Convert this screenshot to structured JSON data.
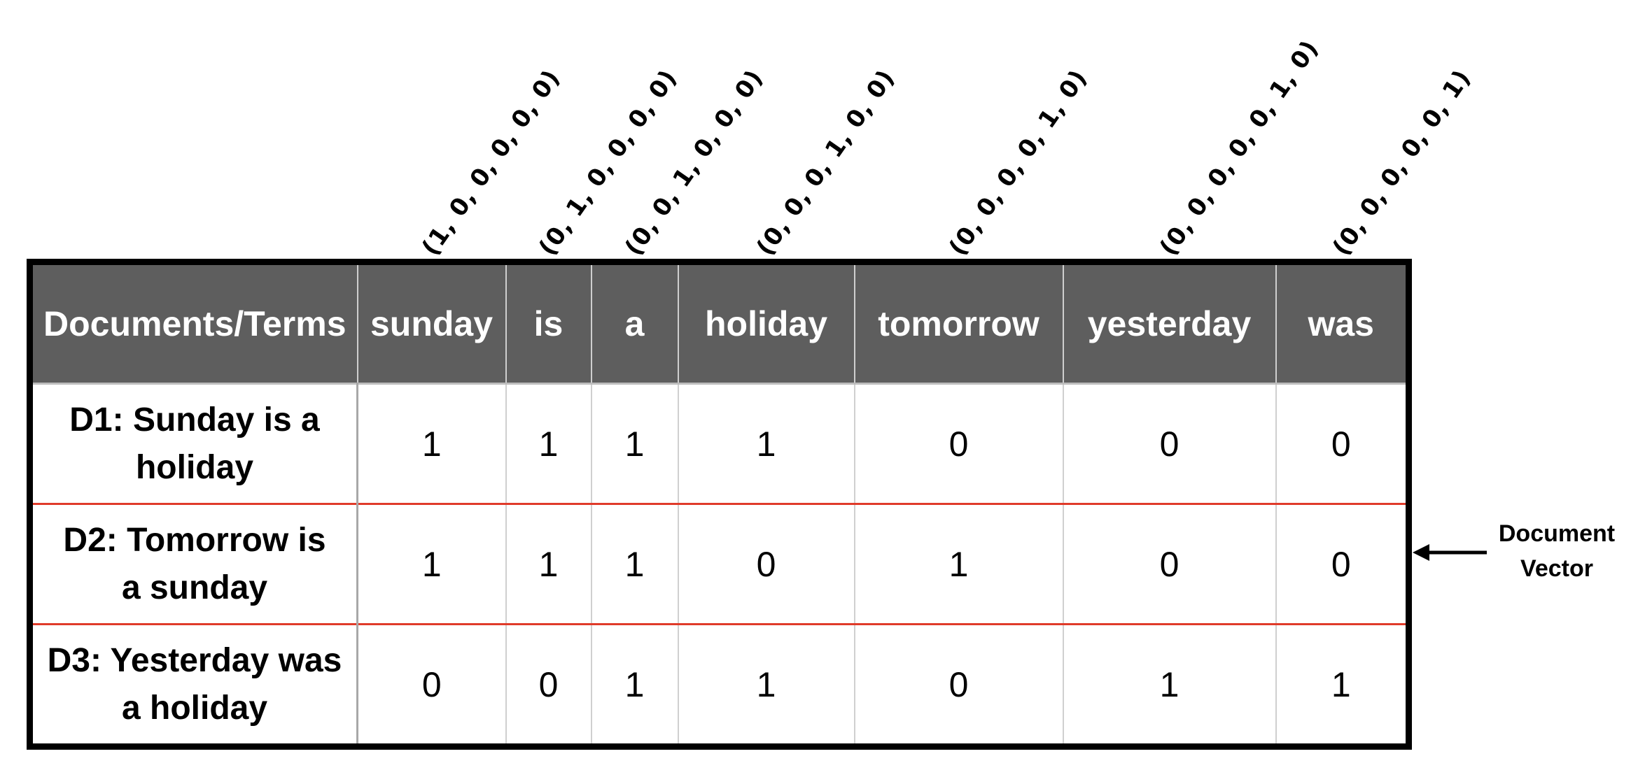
{
  "one_hot_vectors": [
    {
      "term": "sunday",
      "label": "(1, 0, 0, 0, 0, 0)"
    },
    {
      "term": "is",
      "label": "(0, 1, 0, 0, 0, 0)"
    },
    {
      "term": "a",
      "label": "(0, 0, 1, 0, 0, 0)"
    },
    {
      "term": "holiday",
      "label": "(0, 0, 0, 1, 0, 0)"
    },
    {
      "term": "tomorrow",
      "label": "(0, 0, 0, 0, 1, 0)"
    },
    {
      "term": "yesterday",
      "label": "(0, 0, 0, 0, 0, 1, 0)"
    },
    {
      "term": "was",
      "label": "(0, 0, 0, 0, 0, 1)"
    }
  ],
  "table": {
    "corner_header": "Documents/Terms",
    "terms": [
      "sunday",
      "is",
      "a",
      "holiday",
      "tomorrow",
      "yesterday",
      "was"
    ],
    "rows": [
      {
        "doc_line1": "D1: Sunday is a",
        "doc_line2": "holiday",
        "values": [
          1,
          1,
          1,
          1,
          0,
          0,
          0
        ]
      },
      {
        "doc_line1": "D2: Tomorrow is",
        "doc_line2": "a sunday",
        "values": [
          1,
          1,
          1,
          0,
          1,
          0,
          0
        ]
      },
      {
        "doc_line1": "D3: Yesterday was",
        "doc_line2": "a holiday",
        "values": [
          0,
          0,
          1,
          1,
          0,
          1,
          1
        ]
      }
    ]
  },
  "annotation": {
    "line1": "Document",
    "line2": "Vector"
  },
  "colors": {
    "header_bg": "#5e5e5e",
    "row_separator": "#e03b2a",
    "border": "#000000"
  }
}
